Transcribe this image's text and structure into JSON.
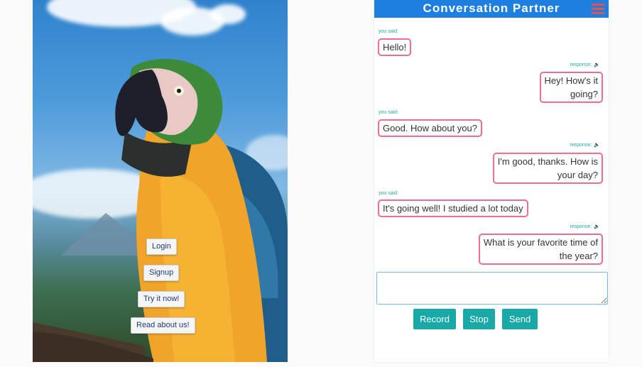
{
  "landing": {
    "buttons": [
      {
        "label": "Login"
      },
      {
        "label": "Signup"
      },
      {
        "label": "Try it now!"
      },
      {
        "label": "Read about us!"
      }
    ]
  },
  "chat": {
    "title": "Conversation Partner",
    "you_label": "you said:",
    "response_label": "response:",
    "messages": [
      {
        "from": "you",
        "text": "Hello!"
      },
      {
        "from": "response",
        "lines": [
          "Hey! How's it",
          "going?"
        ]
      },
      {
        "from": "you",
        "text": "Good. How about you?"
      },
      {
        "from": "response",
        "lines": [
          "I'm good, thanks. How is",
          "your day?"
        ]
      },
      {
        "from": "you",
        "text": "It's going well! I studied a lot today"
      },
      {
        "from": "response",
        "lines": [
          "What is your favorite time of",
          "the year?"
        ]
      }
    ],
    "input_value": "",
    "actions": {
      "record": "Record",
      "stop": "Stop",
      "send": "Send"
    }
  },
  "icons": {
    "menu": "hamburger-menu-icon",
    "speaker": "speaker-icon"
  },
  "colors": {
    "header": "#1e7fe0",
    "bubble_border": "#ee6e8e",
    "button": "#17a8a7",
    "meta_text": "#27a7a4",
    "menu_icon": "#e2554c"
  }
}
